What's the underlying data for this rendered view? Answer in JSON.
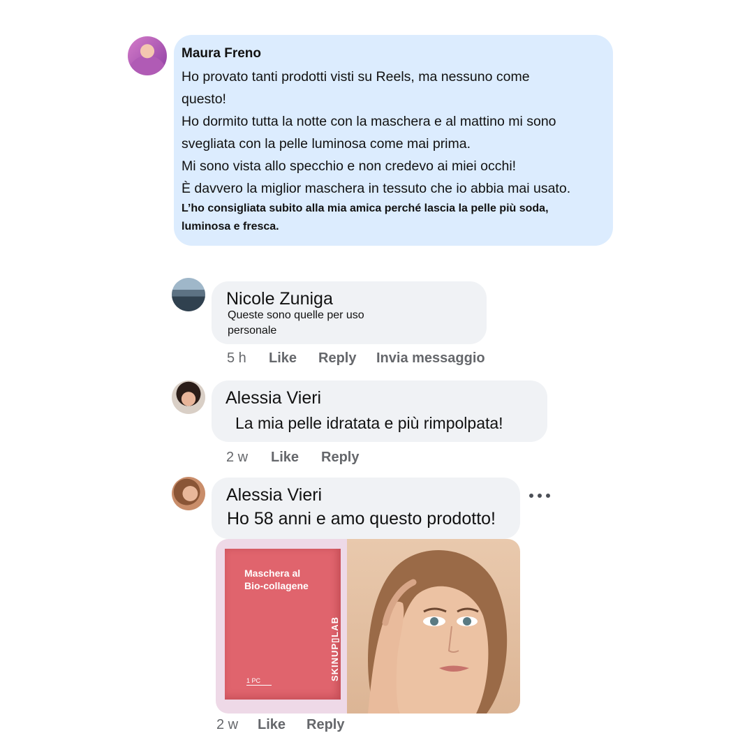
{
  "main_comment": {
    "author": "Maura Freno",
    "lines": [
      " Ho provato tanti prodotti visti su Reels, ma nessuno come",
      "questo!",
      "Ho dormito tutta la notte con la maschera e al mattino mi sono",
      "svegliata con la pelle luminosa come mai prima.",
      "Mi sono vista allo specchio e non credevo ai miei occhi!",
      "È davvero la miglior maschera in tessuto che io abbia mai usato."
    ],
    "small_lines": [
      "L’ho consigliata subito alla mia amica perché lascia la pelle più soda,",
      "luminosa e fresca."
    ]
  },
  "replies": [
    {
      "author": "Nicole Zuniga",
      "text_lines": [
        "Queste sono quelle per uso",
        "personale"
      ],
      "time": "5 h",
      "like": "Like",
      "reply": "Reply",
      "message": "Invia messaggio"
    },
    {
      "author": "Alessia Vieri",
      "text": "La mia pelle idratata e più rimpolpata!",
      "time": "2 w",
      "like": "Like",
      "reply": "Reply"
    },
    {
      "author": "Alessia Vieri",
      "text": "Ho 58 anni e amo questo prodotto!",
      "time": "2 w",
      "like": "Like",
      "reply": "Reply",
      "attachment": {
        "product_title": "Maschera al\nBio-collagene",
        "brand": "SKINUP▯LAB",
        "quantity": "1 PC"
      }
    }
  ],
  "icons": {
    "more": "more-options-icon"
  }
}
